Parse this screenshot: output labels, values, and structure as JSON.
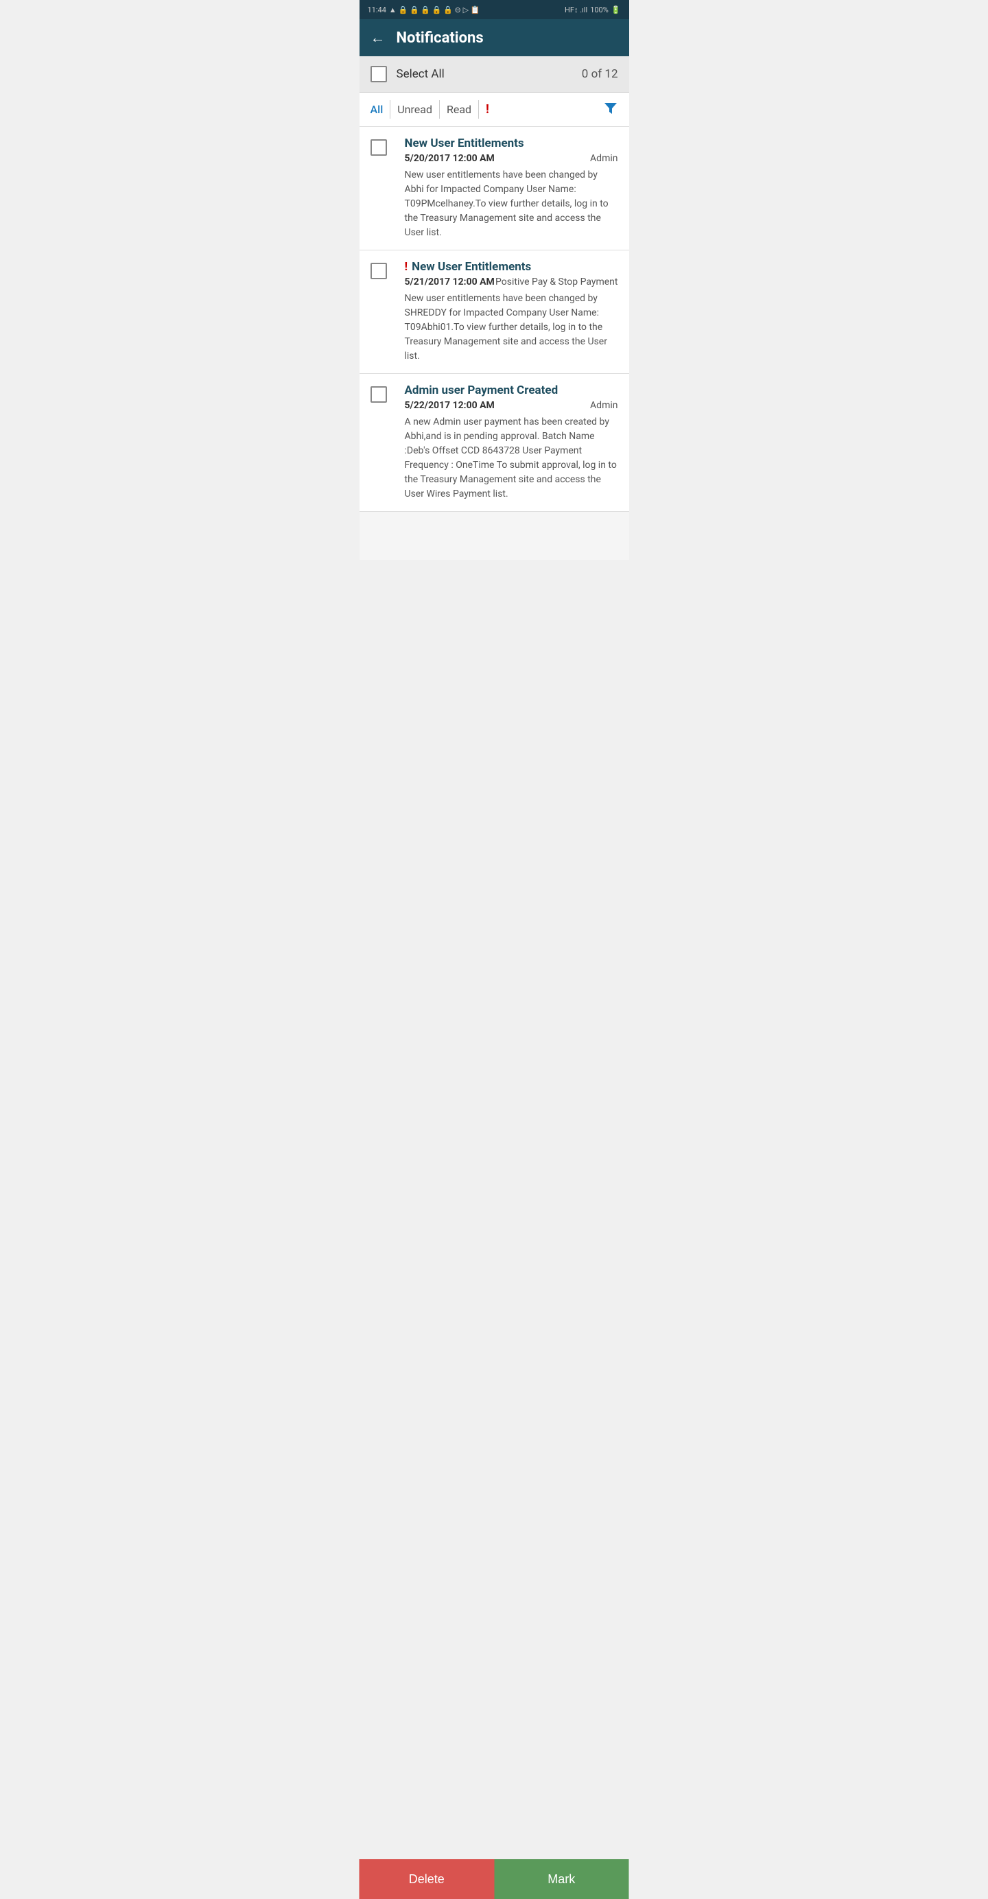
{
  "statusBar": {
    "time": "11:44",
    "battery": "100%",
    "signal": "||||"
  },
  "header": {
    "backLabel": "←",
    "title": "Notifications"
  },
  "selectAllBar": {
    "label": "Select All",
    "count": "0 of 12"
  },
  "filterTabs": {
    "tabs": [
      {
        "id": "all",
        "label": "All",
        "active": true
      },
      {
        "id": "unread",
        "label": "Unread",
        "active": false
      },
      {
        "id": "read",
        "label": "Read",
        "active": false
      }
    ],
    "urgentLabel": "!",
    "filterIconTitle": "Filter"
  },
  "notifications": [
    {
      "id": 1,
      "urgent": false,
      "title": "New User Entitlements",
      "date": "5/20/2017 12:00 AM",
      "source": "Admin",
      "body": "New user entitlements have been changed by Abhi for Impacted Company User Name: T09PMcelhaney.To view further details, log in to the Treasury Management site and access the User list."
    },
    {
      "id": 2,
      "urgent": true,
      "title": "New User Entitlements",
      "date": "5/21/2017 12:00 AM",
      "source": "Positive Pay & Stop Payment",
      "body": "New user entitlements have been changed by SHREDDY for Impacted Company User Name: T09Abhi01.To view further details, log in to the Treasury Management site and access the User list."
    },
    {
      "id": 3,
      "urgent": false,
      "title": "Admin user Payment Created",
      "date": "5/22/2017 12:00 AM",
      "source": "Admin",
      "body": "A new Admin user payment has been created by Abhi,and is in pending approval. Batch Name :Deb's Offset CCD 8643728 User Payment Frequency : OneTime To submit approval, log in to the Treasury Management site and access the User Wires Payment list."
    }
  ],
  "bottomButtons": {
    "deleteLabel": "Delete",
    "markLabel": "Mark"
  }
}
